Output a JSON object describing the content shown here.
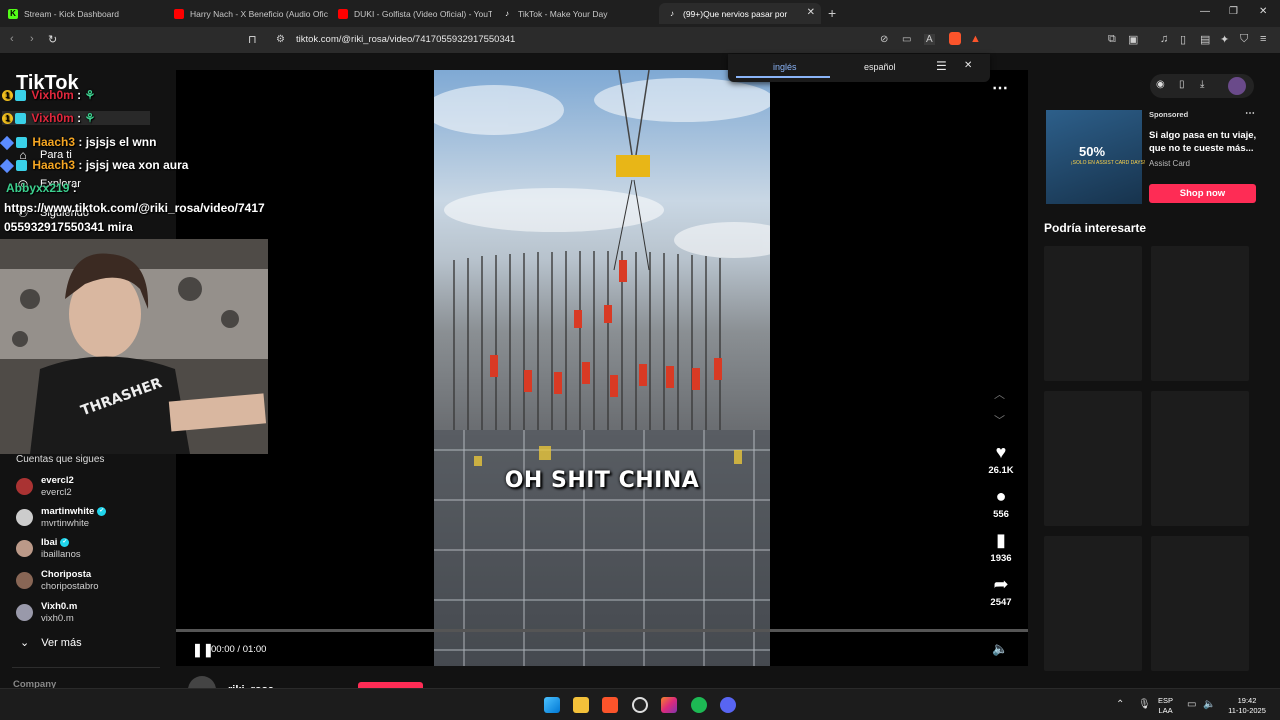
{
  "browser": {
    "tabs": [
      {
        "title": "Stream - Kick Dashboard",
        "favicon": "kick-icon"
      },
      {
        "title": "Harry Nach - X Beneficio (Audio Ofic",
        "favicon": "youtube-icon"
      },
      {
        "title": "DUKI - Golfista (Video Oficial) - YouT",
        "favicon": "youtube-icon"
      },
      {
        "title": "TikTok - Make Your Day",
        "favicon": "tiktok-icon"
      },
      {
        "title": "(99+)Que nervios pasar por",
        "favicon": "tiktok-icon"
      }
    ],
    "url": "tiktok.com/@riki_rosa/video/7417055932917550341"
  },
  "translate_popup": {
    "source": "inglés",
    "target": "español"
  },
  "sidebar": {
    "logo": "TikTok",
    "nav": [
      "Para ti",
      "Explorar",
      "Siguiendo"
    ],
    "following_header": "Cuentas que sigues",
    "following": [
      {
        "name": "evercl2",
        "handle": "evercl2",
        "verified": false,
        "color": "#a33"
      },
      {
        "name": "martinwhite",
        "handle": "mvrtinwhite",
        "verified": true,
        "color": "#ccc"
      },
      {
        "name": "Ibai",
        "handle": "ibaillanos",
        "verified": true,
        "color": "#b98"
      },
      {
        "name": "Choriposta",
        "handle": "choripostabro",
        "verified": false,
        "color": "#865"
      },
      {
        "name": "Vixh0.m",
        "handle": "vixh0.m",
        "verified": false,
        "color": "#99a"
      }
    ],
    "see_more": "Ver más",
    "company": "Company"
  },
  "chat": [
    {
      "user": "Vixh0m",
      "msg": ":",
      "color": "#e0283d"
    },
    {
      "user": "Vixh0m",
      "msg": ":",
      "color": "#e0283d"
    },
    {
      "user": "Haach3",
      "msg": ": jsjsjs el wnn",
      "color": "#f5a623"
    },
    {
      "user": "Haach3",
      "msg": ": jsjsj wea xon aura",
      "color": "#f5a623"
    },
    {
      "user": "Abbyxx219",
      "msg": ":",
      "color": "#3ccf8e"
    },
    {
      "user": "",
      "msg": "https://www.tiktok.com/@riki_rosa/video/7417",
      "color": "#fff"
    },
    {
      "user": "",
      "msg": "055932917550341 mira",
      "color": "#fff"
    }
  ],
  "video": {
    "caption": "OH SHIT CHINA",
    "time": "00:00 / 01:00",
    "progress": 0.0,
    "likes": "26.1K",
    "comments": "556",
    "bookmarks": "1936",
    "shares": "2547",
    "author": "riki_rosa"
  },
  "ad": {
    "sponsored": "Sponsored",
    "title": "Si algo pasa en tu viaje, que no te cueste más...",
    "brand": "Assist Card",
    "cta": "Shop now",
    "img_text": "50%",
    "img_sub": "¡SOLO EN ASSIST CARD DAYS!"
  },
  "suggestions_title": "Podría interesarte",
  "taskbar": {
    "lang": "ESP",
    "layout": "LAA",
    "time": "19:42",
    "date": "11-10-2025"
  }
}
